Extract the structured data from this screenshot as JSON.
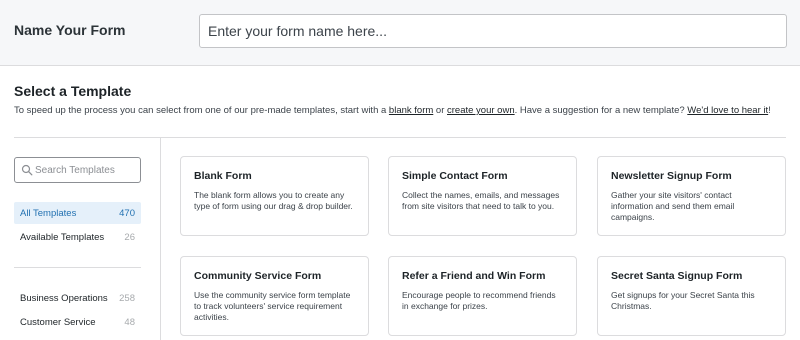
{
  "header": {
    "label": "Name Your Form",
    "name_placeholder": "Enter your form name here..."
  },
  "templates": {
    "title": "Select a Template",
    "intro_before": "To speed up the process you can select from one of our pre-made templates, start with a ",
    "link_blank": "blank form",
    "intro_or": " or ",
    "link_create": "create your own",
    "intro_mid": ". Have a suggestion for a new template? ",
    "link_suggest": "We'd love to hear it",
    "intro_end": "!"
  },
  "sidebar": {
    "search_placeholder": "Search Templates",
    "categories": [
      {
        "name": "All Templates",
        "count": "470",
        "active": true
      },
      {
        "name": "Available Templates",
        "count": "26",
        "active": false
      },
      {
        "name": "Business Operations",
        "count": "258",
        "active": false
      },
      {
        "name": "Customer Service",
        "count": "48",
        "active": false
      }
    ]
  },
  "cards": [
    {
      "title": "Blank Form",
      "desc": "The blank form allows you to create any type of form using our drag & drop builder."
    },
    {
      "title": "Simple Contact Form",
      "desc": "Collect the names, emails, and messages from site visitors that need to talk to you."
    },
    {
      "title": "Newsletter Signup Form",
      "desc": "Gather your site visitors' contact information and send them email campaigns."
    },
    {
      "title": "Community Service Form",
      "desc": "Use the community service form template to track volunteers' service requirement activities."
    },
    {
      "title": "Refer a Friend and Win Form",
      "desc": "Encourage people to recommend friends in exchange for prizes."
    },
    {
      "title": "Secret Santa Signup Form",
      "desc": "Get signups for your Secret Santa this Christmas."
    }
  ],
  "colors": {
    "accent": "#2271b1",
    "active_bg": "#e5f0fa",
    "header_bg": "#f6f7f9",
    "border": "#dcdcde"
  },
  "icons": {
    "search": "search-icon"
  }
}
